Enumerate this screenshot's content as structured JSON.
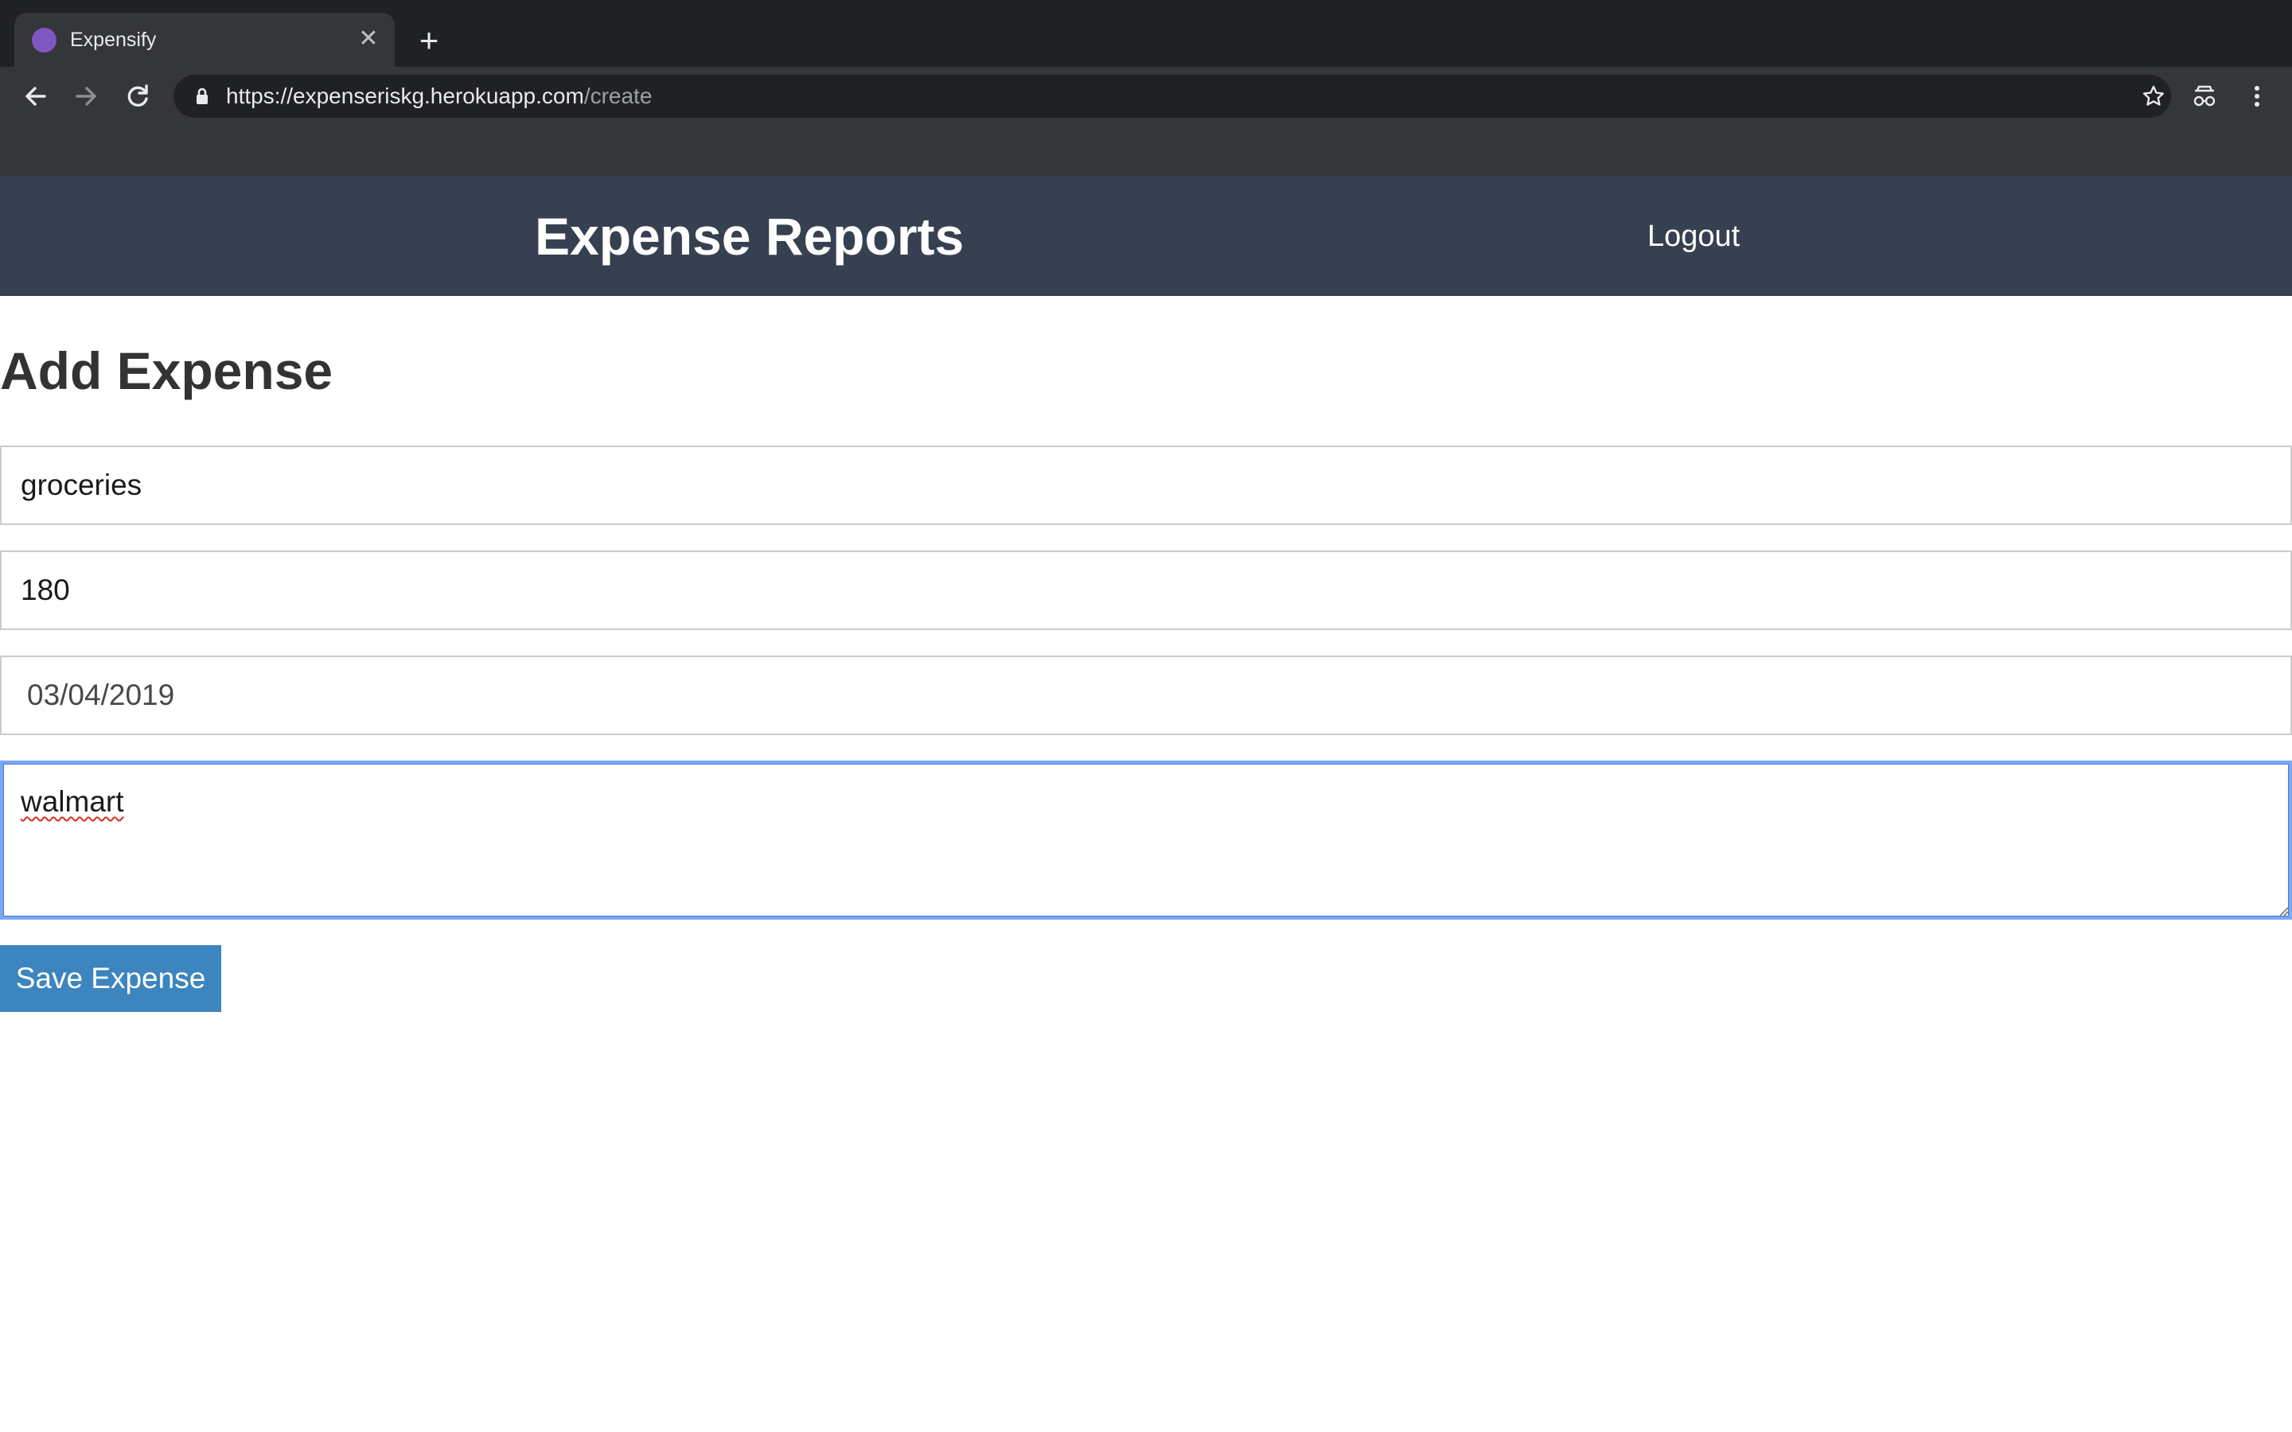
{
  "browser": {
    "tab": {
      "title": "Expensify",
      "favicon_color": "#7e57c2"
    },
    "url": {
      "host": "https://expenseriskg.herokuapp.com",
      "path": "/create"
    }
  },
  "header": {
    "title": "Expense Reports",
    "logout_label": "Logout",
    "background": "#364051"
  },
  "form": {
    "heading": "Add Expense",
    "description_value": "groceries",
    "amount_value": "180",
    "date_value": "03/04/2019",
    "note_value": "walmart",
    "save_label": "Save Expense",
    "button_color": "#3d85be"
  },
  "icons": [
    "back-icon",
    "forward-icon",
    "reload-icon",
    "lock-icon",
    "star-icon",
    "extension-icon",
    "menu-icon",
    "close-icon",
    "plus-icon"
  ]
}
